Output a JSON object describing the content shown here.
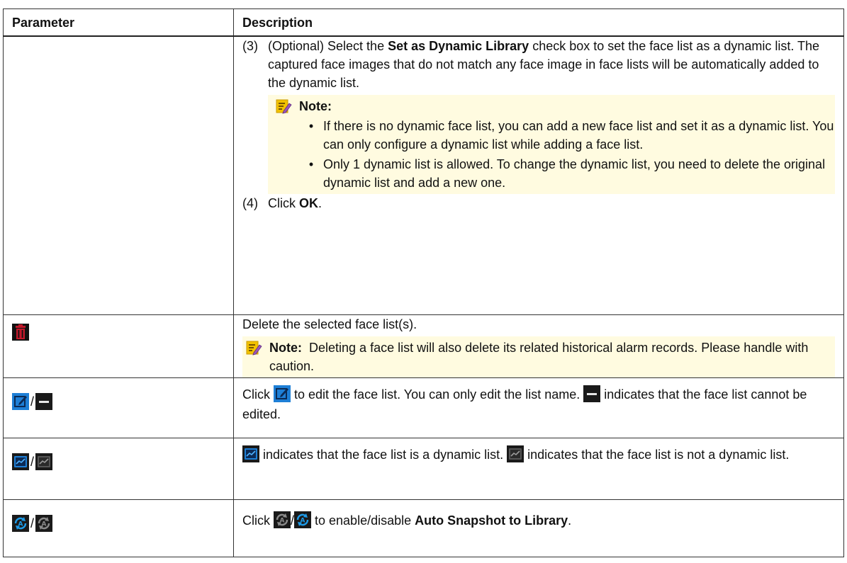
{
  "table": {
    "header": {
      "parameter": "Parameter",
      "description": "Description"
    },
    "main": {
      "step3": {
        "num": "(3)",
        "pre": "(Optional) Select the ",
        "bold": "Set as Dynamic Library",
        "post": " check box to set the face list as a dynamic list. The captured face images that do not match any face image in face lists will be automatically added to the dynamic list."
      },
      "note": {
        "label": "Note:",
        "bullets": [
          "If there is no dynamic face list, you can add a new face list and set it as a dynamic list. You can only configure a dynamic list while adding a face list.",
          "Only 1 dynamic list is allowed. To change the dynamic list, you need to delete the original dynamic list and add a new one."
        ]
      },
      "step4": {
        "num": "(4)",
        "pre": "Click ",
        "bold": "OK",
        "post": "."
      }
    },
    "delete_row": {
      "icon": "trash-icon",
      "description": "Delete the selected face list(s).",
      "note_label": "Note:",
      "note_text": "Deleting a face list will also delete its related historical alarm records. Please handle with caution."
    },
    "edit_row": {
      "icons": [
        "edit-icon",
        "not-editable-icon"
      ],
      "slash": "/",
      "click": "Click ",
      "rest": " to edit the face list. You can only edit the list name. ",
      "rest2": " indicates that the face list cannot be edited."
    },
    "dynamic_row": {
      "icons": [
        "dynamic-list-icon",
        "non-dynamic-list-icon"
      ],
      "slash": "/",
      "text1": " indicates that the face list is a dynamic list. ",
      "text2": " indicates that the face list is not a dynamic list."
    },
    "auto_row": {
      "icons": [
        "auto-snapshot-disabled-icon",
        "auto-snapshot-enabled-icon"
      ],
      "slash": "/",
      "click": "Click ",
      "mid": "/",
      "rest": " to enable/disable ",
      "bold": "Auto Snapshot to Library",
      "end": "."
    }
  },
  "colors": {
    "note_bg": "#fffbe0",
    "edit_icon": "#1e7fd6",
    "trash_icon": "#c0182a"
  }
}
